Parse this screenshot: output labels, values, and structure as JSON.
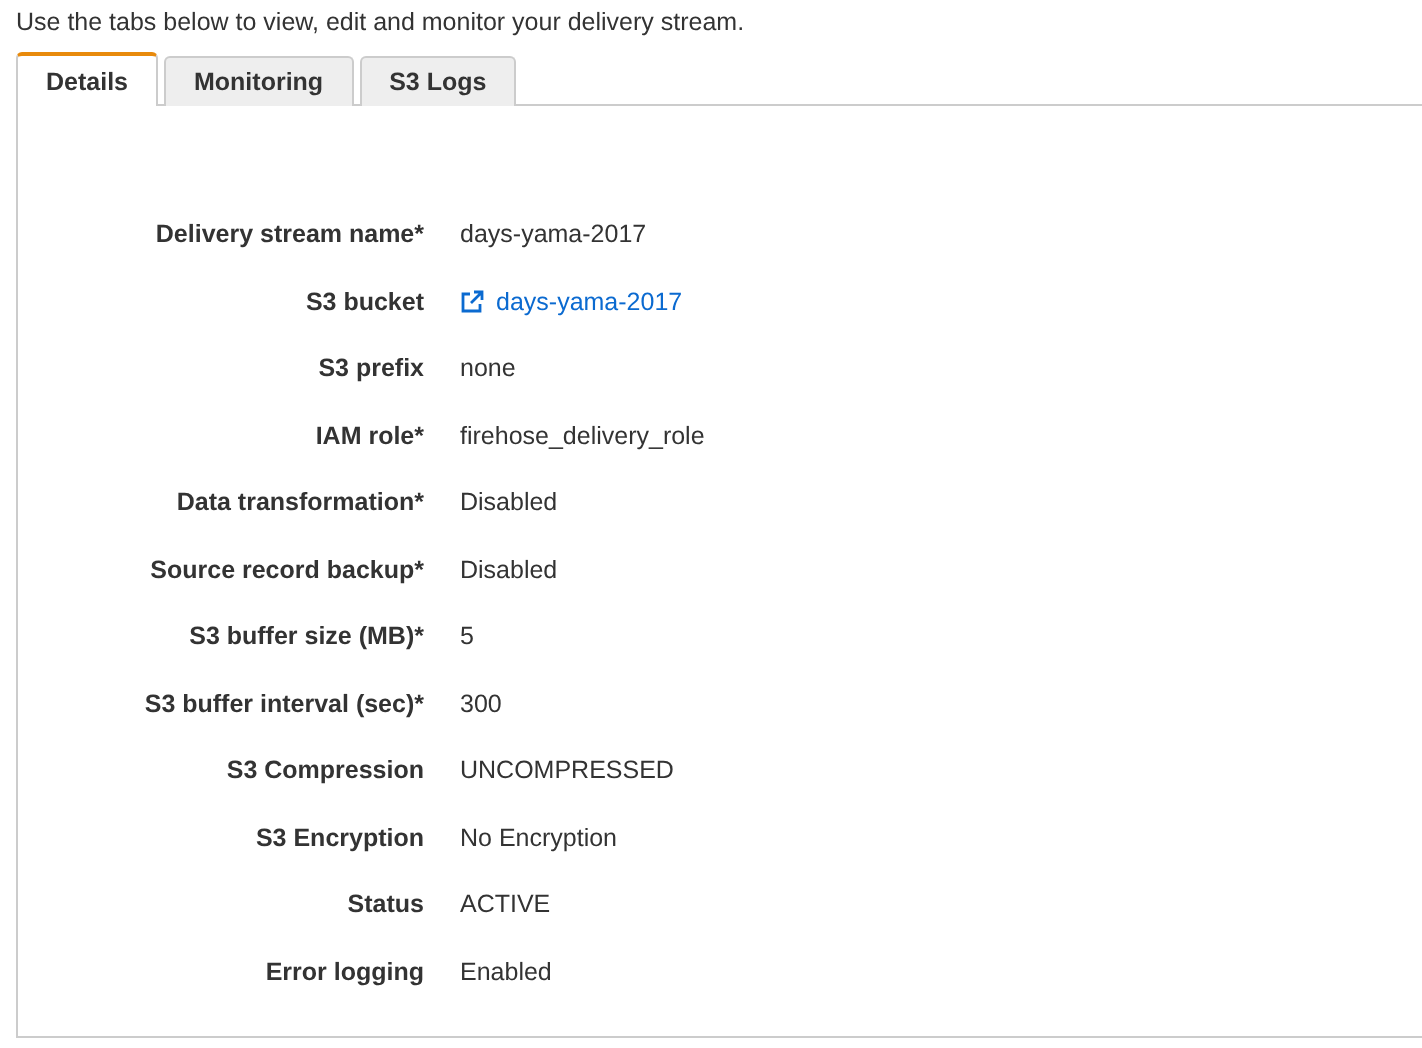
{
  "intro": "Use the tabs below to view, edit and monitor your delivery stream.",
  "tabs": [
    {
      "label": "Details",
      "selected": true
    },
    {
      "label": "Monitoring",
      "selected": false
    },
    {
      "label": "S3 Logs",
      "selected": false
    }
  ],
  "details": [
    {
      "label": "Delivery stream name*",
      "value": "days-yama-2017",
      "kind": "text"
    },
    {
      "label": "S3 bucket",
      "value": "days-yama-2017",
      "kind": "link"
    },
    {
      "label": "S3 prefix",
      "value": "none",
      "kind": "text"
    },
    {
      "label": "IAM role*",
      "value": "firehose_delivery_role",
      "kind": "text"
    },
    {
      "label": "Data transformation*",
      "value": "Disabled",
      "kind": "text"
    },
    {
      "label": "Source record backup*",
      "value": "Disabled",
      "kind": "text"
    },
    {
      "label": "S3 buffer size (MB)*",
      "value": "5",
      "kind": "text"
    },
    {
      "label": "S3 buffer interval (sec)*",
      "value": "300",
      "kind": "text"
    },
    {
      "label": "S3 Compression",
      "value": "UNCOMPRESSED",
      "kind": "text"
    },
    {
      "label": "S3 Encryption",
      "value": "No Encryption",
      "kind": "text"
    },
    {
      "label": "Status",
      "value": "ACTIVE",
      "kind": "text"
    },
    {
      "label": "Error logging",
      "value": "Enabled",
      "kind": "text"
    }
  ]
}
